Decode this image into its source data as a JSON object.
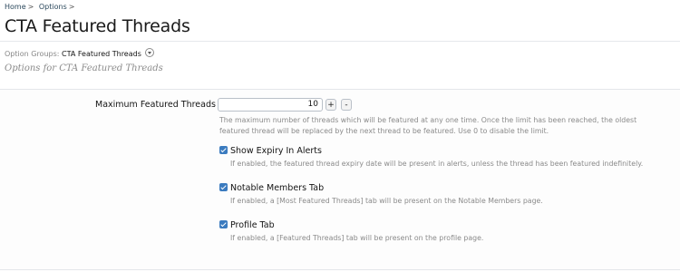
{
  "breadcrumb": {
    "items": [
      "Home",
      "Options"
    ],
    "separator": ">"
  },
  "page": {
    "title": "CTA Featured Threads"
  },
  "option_groups": {
    "label": "Option Groups:",
    "current": "CTA Featured Threads"
  },
  "subtitle": "Options for CTA Featured Threads",
  "max_threads": {
    "label": "Maximum Featured Threads",
    "value": "10",
    "plus": "+",
    "minus": "-",
    "hint_line1": "The maximum number of threads which will be featured at any one time. Once the limit has been reached, the oldest",
    "hint_line2": "featured thread will be replaced by the next thread to be featured. Use 0 to disable the limit."
  },
  "options": [
    {
      "label": "Show Expiry In Alerts",
      "checked": true,
      "hint": "If enabled, the featured thread expiry date will be present in alerts, unless the thread has been featured indefinitely."
    },
    {
      "label": "Notable Members Tab",
      "checked": true,
      "hint": "If enabled, a [Most Featured Threads] tab will be present on the Notable Members page."
    },
    {
      "label": "Profile Tab",
      "checked": true,
      "hint": "If enabled, a [Featured Threads] tab will be present on the profile page."
    }
  ],
  "colors": {
    "link": "#2b485c",
    "checkbox": "#3b7bbf"
  }
}
